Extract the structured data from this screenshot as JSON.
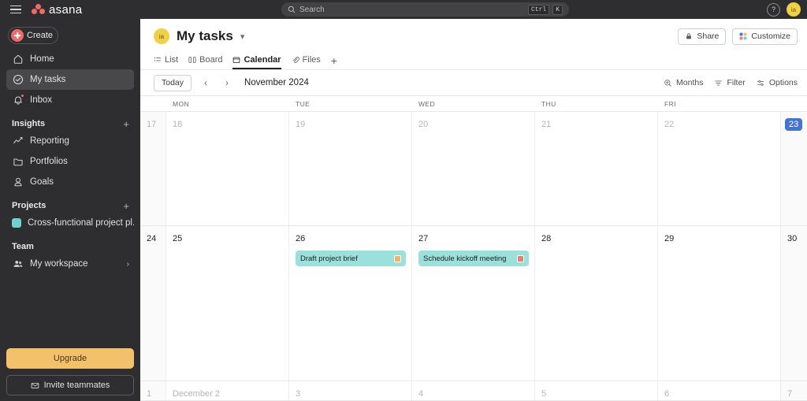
{
  "topbar": {
    "menu_icon": "hamburger-icon",
    "brand_name": "asana",
    "search": {
      "placeholder": "Search",
      "icon": "search-icon",
      "shortcut_keys": [
        "Ctrl",
        "K"
      ]
    },
    "help_label": "?",
    "avatar_initials": "ia"
  },
  "sidebar": {
    "create_label": "Create",
    "nav": [
      {
        "label": "Home",
        "icon": "home-icon",
        "active": false
      },
      {
        "label": "My tasks",
        "icon": "check-circle-icon",
        "active": true
      },
      {
        "label": "Inbox",
        "icon": "bell-icon",
        "active": false,
        "has_badge": true
      }
    ],
    "sections": [
      {
        "title": "Insights",
        "has_add": true,
        "items": [
          {
            "label": "Reporting",
            "icon": "chart-line-icon"
          },
          {
            "label": "Portfolios",
            "icon": "folder-icon"
          },
          {
            "label": "Goals",
            "icon": "goal-icon"
          }
        ]
      },
      {
        "title": "Projects",
        "has_add": true,
        "items": [
          {
            "label": "Cross-functional project pl...",
            "icon": "project-dot-icon",
            "color": "#6ed3cf"
          }
        ]
      },
      {
        "title": "Team",
        "has_add": false,
        "items": [
          {
            "label": "My workspace",
            "icon": "people-icon",
            "chevron": "chevron-right-icon"
          }
        ]
      }
    ],
    "upgrade_label": "Upgrade",
    "invite_label": "Invite teammates",
    "invite_icon": "envelope-icon"
  },
  "header": {
    "avatar_initials": "ia",
    "title": "My tasks",
    "title_caret": "chevron-down-icon",
    "share_label": "Share",
    "share_icon": "lock-icon",
    "customize_label": "Customize",
    "customize_icon": "grid-color-icon",
    "tabs": [
      {
        "label": "List",
        "icon": "list-icon",
        "active": false
      },
      {
        "label": "Board",
        "icon": "board-icon",
        "active": false
      },
      {
        "label": "Calendar",
        "icon": "calendar-icon",
        "active": true
      },
      {
        "label": "Files",
        "icon": "file-icon",
        "active": false
      }
    ],
    "tab_add": "+"
  },
  "toolbar": {
    "today_label": "Today",
    "prev_icon": "chevron-left-icon",
    "next_icon": "chevron-right-icon",
    "month_label": "November 2024",
    "months_label": "Months",
    "months_icon": "zoom-icon",
    "filter_label": "Filter",
    "filter_icon": "filter-icon",
    "options_label": "Options",
    "options_icon": "sliders-icon"
  },
  "calendar": {
    "day_headers": [
      "MON",
      "TUE",
      "WED",
      "THU",
      "FRI"
    ],
    "weeks": [
      {
        "days": [
          {
            "num": "17",
            "muted": true,
            "weekend": true,
            "narrow": true,
            "today": false,
            "tasks": []
          },
          {
            "num": "18",
            "muted": true,
            "weekend": false,
            "narrow": false,
            "today": false,
            "tasks": []
          },
          {
            "num": "19",
            "muted": true,
            "weekend": false,
            "narrow": false,
            "today": false,
            "tasks": []
          },
          {
            "num": "20",
            "muted": true,
            "weekend": false,
            "narrow": false,
            "today": false,
            "tasks": []
          },
          {
            "num": "21",
            "muted": true,
            "weekend": false,
            "narrow": false,
            "today": false,
            "tasks": []
          },
          {
            "num": "22",
            "muted": true,
            "weekend": false,
            "narrow": false,
            "today": false,
            "tasks": []
          },
          {
            "num": "23",
            "muted": false,
            "weekend": true,
            "narrow": true,
            "today": true,
            "tasks": []
          }
        ]
      },
      {
        "days": [
          {
            "num": "24",
            "muted": false,
            "weekend": true,
            "narrow": true,
            "today": false,
            "tasks": []
          },
          {
            "num": "25",
            "muted": false,
            "weekend": false,
            "narrow": false,
            "today": false,
            "tasks": []
          },
          {
            "num": "26",
            "muted": false,
            "weekend": false,
            "narrow": false,
            "today": false,
            "tasks": [
              {
                "name": "Draft project brief",
                "badge_color": "#efb75e"
              }
            ]
          },
          {
            "num": "27",
            "muted": false,
            "weekend": false,
            "narrow": false,
            "today": false,
            "tasks": [
              {
                "name": "Schedule kickoff meeting",
                "badge_color": "#e8806b"
              }
            ]
          },
          {
            "num": "28",
            "muted": false,
            "weekend": false,
            "narrow": false,
            "today": false,
            "tasks": []
          },
          {
            "num": "29",
            "muted": false,
            "weekend": false,
            "narrow": false,
            "today": false,
            "tasks": []
          },
          {
            "num": "30",
            "muted": false,
            "weekend": true,
            "narrow": true,
            "today": false,
            "tasks": []
          }
        ]
      },
      {
        "days": [
          {
            "num": "1",
            "muted": true,
            "weekend": true,
            "narrow": true,
            "today": false,
            "tasks": []
          },
          {
            "num": "December 2",
            "muted": true,
            "weekend": false,
            "narrow": false,
            "today": false,
            "tasks": []
          },
          {
            "num": "3",
            "muted": true,
            "weekend": false,
            "narrow": false,
            "today": false,
            "tasks": []
          },
          {
            "num": "4",
            "muted": true,
            "weekend": false,
            "narrow": false,
            "today": false,
            "tasks": []
          },
          {
            "num": "5",
            "muted": true,
            "weekend": false,
            "narrow": false,
            "today": false,
            "tasks": []
          },
          {
            "num": "6",
            "muted": true,
            "weekend": false,
            "narrow": false,
            "today": false,
            "tasks": []
          },
          {
            "num": "7",
            "muted": true,
            "weekend": true,
            "narrow": true,
            "today": false,
            "tasks": []
          }
        ]
      }
    ]
  },
  "colors": {
    "brand": "#f06a6a",
    "today_blue": "#4573d2",
    "task_card": "#9ce0db",
    "upgrade": "#f3c06b",
    "avatar": "#f1d049"
  }
}
